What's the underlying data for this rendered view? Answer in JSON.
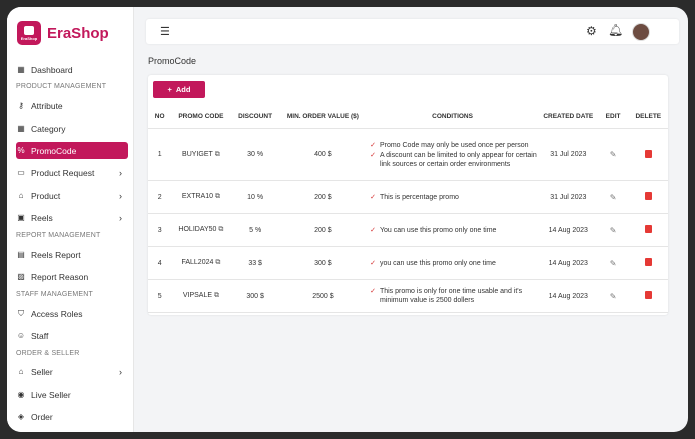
{
  "brand": {
    "name": "EraShop",
    "logo_text": "EraShop"
  },
  "sidebar": {
    "items": [
      {
        "label": "Dashboard",
        "icon": "grid-icon"
      },
      {
        "section": "PRODUCT MANAGEMENT"
      },
      {
        "label": "Attribute",
        "icon": "key-icon"
      },
      {
        "label": "Category",
        "icon": "table-icon"
      },
      {
        "label": "PromoCode",
        "icon": "percent-icon",
        "active": true
      },
      {
        "label": "Product Request",
        "icon": "cart-icon",
        "chevron": true
      },
      {
        "label": "Product",
        "icon": "basket-icon",
        "chevron": true
      },
      {
        "label": "Reels",
        "icon": "film-icon",
        "chevron": true
      },
      {
        "section": "REPORT MANAGEMENT"
      },
      {
        "label": "Reels Report",
        "icon": "doc-icon"
      },
      {
        "label": "Report Reason",
        "icon": "image-icon"
      },
      {
        "section": "STAFF MANAGEMENT"
      },
      {
        "label": "Access Roles",
        "icon": "shield-icon"
      },
      {
        "label": "Staff",
        "icon": "users-icon"
      },
      {
        "section": "ORDER & SELLER"
      },
      {
        "label": "Seller",
        "icon": "store-icon",
        "chevron": true
      },
      {
        "label": "Live Seller",
        "icon": "broadcast-icon"
      },
      {
        "label": "Order",
        "icon": "box-icon"
      }
    ]
  },
  "page": {
    "title": "PromoCode",
    "add_label": "Add"
  },
  "table": {
    "headers": [
      "NO",
      "PROMO CODE",
      "DISCOUNT",
      "MIN. ORDER VALUE ($)",
      "CONDITIONS",
      "CREATED DATE",
      "EDIT",
      "DELETE"
    ],
    "rows": [
      {
        "no": "1",
        "code": "BUYIGET",
        "discount": "30 %",
        "min": "400 $",
        "conditions": [
          "Promo Code may only be used once per person",
          "A discount can be limited to only appear for certain link sources or certain order environments"
        ],
        "date": "31 Jul 2023"
      },
      {
        "no": "2",
        "code": "EXTRA10",
        "discount": "10 %",
        "min": "200 $",
        "conditions": [
          "This is percentage promo"
        ],
        "date": "31 Jul 2023"
      },
      {
        "no": "3",
        "code": "HOLIDAY50",
        "discount": "5 %",
        "min": "200 $",
        "conditions": [
          "You can use this promo only one time"
        ],
        "date": "14 Aug 2023"
      },
      {
        "no": "4",
        "code": "FALL2024",
        "discount": "33 $",
        "min": "300 $",
        "conditions": [
          "you can use this promo only one time"
        ],
        "date": "14 Aug 2023"
      },
      {
        "no": "5",
        "code": "VIPSALE",
        "discount": "300 $",
        "min": "2500 $",
        "conditions": [
          "This promo is only for one time usable and it's minimum value is 2500 dollers"
        ],
        "date": "14 Aug 2023"
      }
    ]
  },
  "colors": {
    "accent": "#c2185b",
    "delete": "#e53935"
  }
}
